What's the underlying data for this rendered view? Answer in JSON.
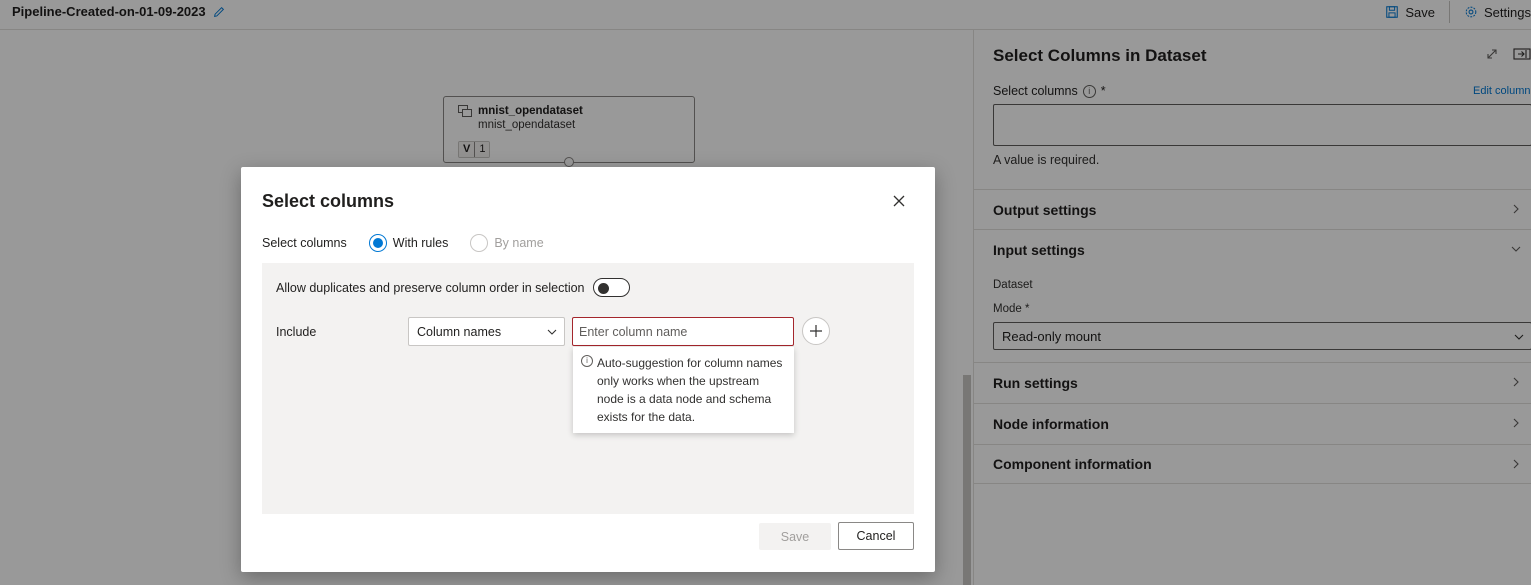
{
  "topbar": {
    "pipeline_name": "Pipeline-Created-on-01-09-2023",
    "save_label": "Save",
    "settings_label": "Settings"
  },
  "canvas": {
    "node": {
      "title": "mnist_opendataset",
      "subtitle": "mnist_opendataset",
      "version_label": "V",
      "version_number": "1"
    }
  },
  "panel": {
    "title": "Select Columns in Dataset",
    "select_columns_label": "Select columns",
    "required_star": "*",
    "edit_columns_link": "Edit column",
    "required_message": "A value is required.",
    "sections": {
      "output": "Output settings",
      "input": "Input settings",
      "run": "Run settings",
      "node": "Node information",
      "component": "Component information"
    },
    "input": {
      "dataset_label": "Dataset",
      "mode_label": "Mode *",
      "mode_value": "Read-only mount"
    }
  },
  "dialog": {
    "title": "Select columns",
    "select_columns_label": "Select columns",
    "radio_with_rules": "With rules",
    "radio_by_name": "By name",
    "selected_radio": "with_rules",
    "dup_label": "Allow duplicates and preserve column order in selection",
    "dup_toggle": false,
    "include_label": "Include",
    "dropdown_value": "Column names",
    "column_input_placeholder": "Enter column name",
    "tooltip": "Auto-suggestion for column names only works when the upstream node is a data node and schema exists for the data.",
    "save_label": "Save",
    "cancel_label": "Cancel"
  },
  "colors": {
    "accent": "#0078d4",
    "error": "#a4262c",
    "overlay": "rgba(0,0,0,0.4)"
  }
}
